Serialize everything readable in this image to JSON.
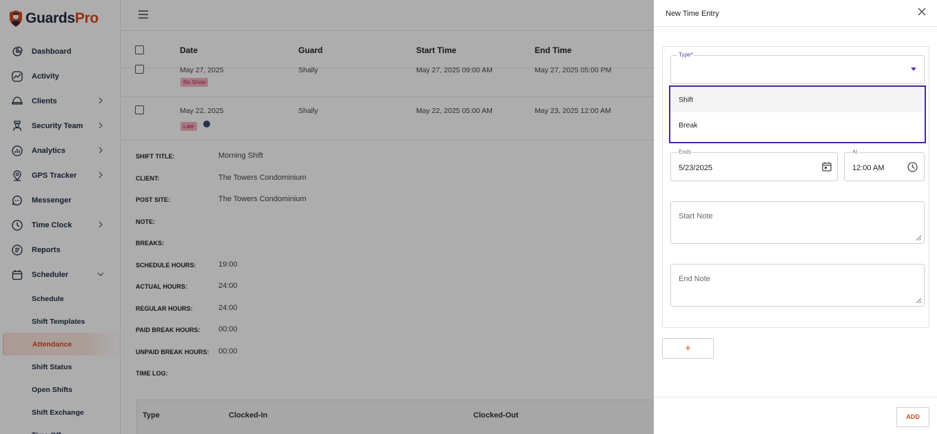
{
  "brand": {
    "part1": "Guards",
    "part2": "Pro",
    "accent": "#d9481c",
    "navy": "#1f2a44"
  },
  "sidebar": {
    "items": [
      {
        "label": "Dashboard",
        "icon": "pie-chart-icon"
      },
      {
        "label": "Activity",
        "icon": "activity-icon"
      },
      {
        "label": "Clients",
        "icon": "helmet-icon",
        "has_children": true
      },
      {
        "label": "Security Team",
        "icon": "guard-icon",
        "has_children": true
      },
      {
        "label": "Analytics",
        "icon": "analytics-icon",
        "has_children": true
      },
      {
        "label": "GPS Tracker",
        "icon": "location-pin-icon",
        "has_children": true
      },
      {
        "label": "Messenger",
        "icon": "chat-bubble-icon"
      },
      {
        "label": "Time Clock",
        "icon": "clock-icon",
        "has_children": true
      },
      {
        "label": "Reports",
        "icon": "report-icon"
      },
      {
        "label": "Scheduler",
        "icon": "calendar-icon",
        "expanded": true
      }
    ],
    "sub_items": [
      {
        "label": "Schedule"
      },
      {
        "label": "Shift Templates"
      },
      {
        "label": "Attendance",
        "active": true
      },
      {
        "label": "Shift Status"
      },
      {
        "label": "Open Shifts"
      },
      {
        "label": "Shift Exchange"
      },
      {
        "label": "Time Off"
      }
    ]
  },
  "table": {
    "columns": [
      "Date",
      "Guard",
      "Start Time",
      "End Time"
    ],
    "rows": [
      {
        "date": "May 27, 2025",
        "guard": "Shally",
        "start": "May 27, 2025 09:00 AM",
        "end": "May 27, 2025 05:00 PM",
        "badge": "No Show"
      },
      {
        "date": "May 22, 2025",
        "guard": "Shally",
        "start": "May 22, 2025 05:00 AM",
        "end": "May 23, 2025 12:00 AM",
        "badge": "Late"
      }
    ]
  },
  "details": [
    {
      "label": "SHIFT TITLE:",
      "value": "Morning Shift"
    },
    {
      "label": "CLIENT:",
      "value": "The Towers Condominium"
    },
    {
      "label": "POST SITE:",
      "value": "The Towers Condominium"
    },
    {
      "label": "NOTE:",
      "value": ""
    },
    {
      "label": "BREAKS:",
      "value": ""
    },
    {
      "label": "SCHEDULE HOURS:",
      "value": "19:00"
    },
    {
      "label": "ACTUAL HOURS:",
      "value": "24:00"
    },
    {
      "label": "REGULAR HOURS:",
      "value": "24:00"
    },
    {
      "label": "PAID BREAK HOURS:",
      "value": "00:00"
    },
    {
      "label": "UNPAID BREAK HOURS:",
      "value": "00:00"
    },
    {
      "label": "TIME LOG:",
      "value": ""
    }
  ],
  "time_log": {
    "columns": [
      "Type",
      "Clocked-In",
      "Clocked-Out"
    ]
  },
  "panel": {
    "title": "New Time Entry",
    "type_label": "Type",
    "type_required": "*",
    "type_value": "",
    "type_options": [
      "Shift",
      "Break"
    ],
    "ends_label": "Ends",
    "ends_value": "5/23/2025",
    "at_label": "At",
    "at_value": "12:00 AM",
    "start_note_placeholder": "Start Note",
    "end_note_placeholder": "End Note",
    "plus_label": "+",
    "add_label": "ADD",
    "focus_color": "#4527a0"
  }
}
